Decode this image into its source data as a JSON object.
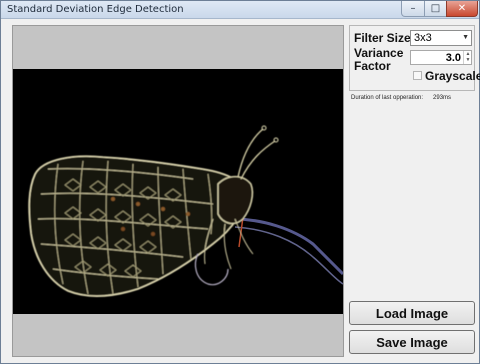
{
  "window": {
    "title": "Standard Deviation Edge Detection",
    "minimize_glyph": "–",
    "maximize_glyph": "□",
    "close_glyph": "✕"
  },
  "settings": {
    "filter_size_label": "Filter Size",
    "filter_size_value": "3x3",
    "variance_label": "Variance Factor",
    "variance_value": "3.0",
    "grayscale_label": "Grayscale",
    "grayscale_checked": false
  },
  "status": {
    "duration_label": "Duration of last opperation:",
    "duration_value": "293ms"
  },
  "buttons": {
    "load_label": "Load Image",
    "save_label": "Save Image"
  },
  "icons": {
    "dropdown": "chevron-down-icon",
    "spin_up": "spin-up-icon",
    "spin_down": "spin-down-icon"
  },
  "colors": {
    "image_background": "#000000",
    "panel_gray": "#c4c4c4",
    "edge_glow": "#d8d2a8"
  }
}
